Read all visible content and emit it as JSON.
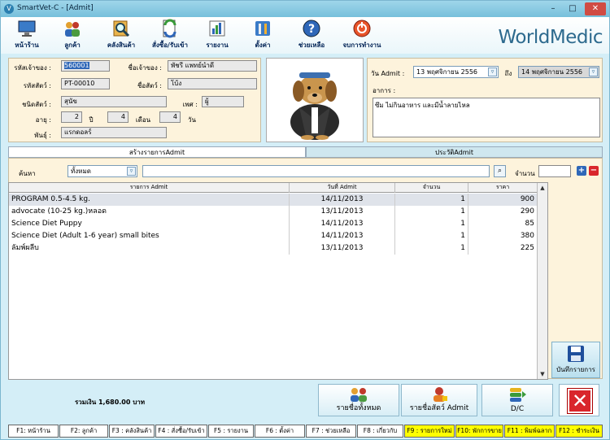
{
  "window": {
    "title": "SmartVet-C - [Admit]"
  },
  "toolbar": {
    "items": [
      {
        "label": "หน้าร้าน",
        "icon": "monitor-icon"
      },
      {
        "label": "ลูกค้า",
        "icon": "customers-icon"
      },
      {
        "label": "คลังสินค้า",
        "icon": "warehouse-search-icon"
      },
      {
        "label": "สั่งซื้อ/รับเข้า",
        "icon": "order-receive-icon"
      },
      {
        "label": "รายงาน",
        "icon": "report-chart-icon"
      },
      {
        "label": "ตั้งค่า",
        "icon": "settings-tools-icon"
      },
      {
        "label": "ช่วยเหลือ",
        "icon": "help-icon"
      },
      {
        "label": "จบการทำงาน",
        "icon": "power-icon"
      }
    ],
    "logo": "WorldMedic"
  },
  "owner": {
    "owner_id_label": "รหัสเจ้าของ :",
    "owner_id": "560001",
    "owner_name_label": "ชื่อเจ้าของ :",
    "owner_name": "พัชรี  แพทย์นำดี",
    "pet_id_label": "รหัสสัตว์ :",
    "pet_id": "PT-00010",
    "pet_name_label": "ชื่อสัตว์ :",
    "pet_name": "โบ้ง",
    "species_label": "ชนิดสัตว์ :",
    "species": "สุนัข",
    "sex_label": "เพศ :",
    "sex": "ผู้",
    "age_label": "อายุ :",
    "age_years": "2",
    "years_unit": "ปี",
    "age_months": "4",
    "months_unit": "เดือน",
    "age_days": "4",
    "days_unit": "วัน",
    "breed_label": "พันธุ์ :",
    "breed": "แรกดอลร์"
  },
  "admit": {
    "date_label": "วัน Admit :",
    "date_from": "13 พฤศจิกายน   2556",
    "to_label": "ถึง",
    "date_to": "14 พฤศจิกายน   2556",
    "symptom_label": "อาการ :",
    "symptom": "ซึม ไม่กินอาหาร และมีน้ำลายไหล"
  },
  "tabs": [
    {
      "label": "สร้างรายการAdmit",
      "active": true
    },
    {
      "label": "ประวัติAdmit",
      "active": false
    }
  ],
  "search": {
    "label": "ค้นหา",
    "category": "ทั้งหมด",
    "query": "",
    "qty_label": "จำนวน",
    "qty": ""
  },
  "table": {
    "columns": [
      "รายการ Admit",
      "วันที่ Admit",
      "จำนวน",
      "ราคา"
    ],
    "rows": [
      [
        "PROGRAM  0.5-4.5 kg.",
        "14/11/2013",
        "1",
        "900"
      ],
      [
        "advocate (10-25 kg.)หลอด",
        "13/11/2013",
        "1",
        "290"
      ],
      [
        "Science Diet  Puppy",
        "14/11/2013",
        "1",
        "85"
      ],
      [
        "Science Diet  (Adult 1-6 year) small bites",
        "14/11/2013",
        "1",
        "380"
      ],
      [
        "ลัมพ์ผลีบ",
        "13/11/2013",
        "1",
        "225"
      ]
    ]
  },
  "actions": {
    "save_label": "บันทึกรายการ",
    "total_label": "รวมเงิน  1,680.00  บาท",
    "list_all_label": "รายชื่อทั้งหมด",
    "list_admit_label": "รายชื่อสัตว์ Admit",
    "dc_label": "D/C"
  },
  "fkeys": [
    {
      "label": "F1: หน้าร้าน",
      "highlight": false
    },
    {
      "label": "F2: ลูกค้า",
      "highlight": false
    },
    {
      "label": "F3 : คลังสินค้า",
      "highlight": false
    },
    {
      "label": "F4 : สั่งซื้อ/รับเข้า",
      "highlight": false
    },
    {
      "label": "F5 : รายงาน",
      "highlight": false
    },
    {
      "label": "F6 : ตั้งค่า",
      "highlight": false
    },
    {
      "label": "F7 : ช่วยเหลือ",
      "highlight": false
    },
    {
      "label": "F8 : เกี่ยวกับ",
      "highlight": false
    },
    {
      "label": "F9 : รายการใหม่",
      "highlight": true
    },
    {
      "label": "F10: พักการขาย",
      "highlight": true
    },
    {
      "label": "F11 : พิมพ์ฉลาก",
      "highlight": true
    },
    {
      "label": "F12 : ชำระเงิน",
      "highlight": true
    }
  ],
  "colors": {
    "accent": "#2f67b8",
    "fkey_highlight": "#ffff00",
    "close_red": "#d9262c"
  }
}
